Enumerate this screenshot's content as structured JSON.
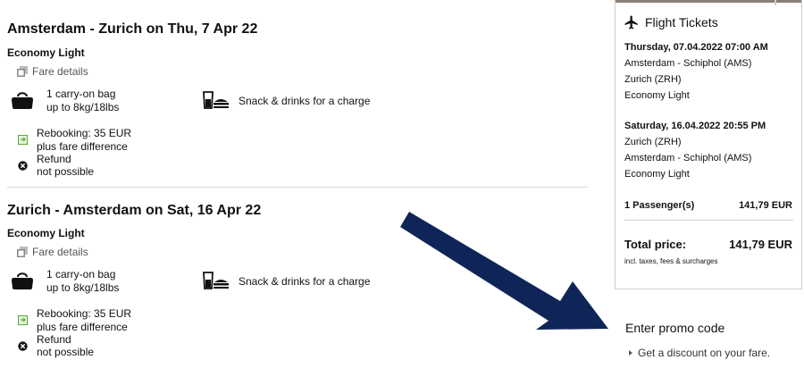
{
  "outbound": {
    "title": "Amsterdam - Zurich on Thu, 7 Apr 22",
    "fare_name": "Economy Light",
    "fare_details_label": "Fare details",
    "bag_line1": "1 carry-on bag",
    "bag_line2": "up to 8kg/18lbs",
    "snack_label": "Snack & drinks for a charge",
    "rebook_line1": "Rebooking: 35 EUR",
    "rebook_line2": "plus fare difference",
    "refund_line1": "Refund",
    "refund_line2": "not possible"
  },
  "inbound": {
    "title": "Zurich - Amsterdam on Sat, 16 Apr 22",
    "fare_name": "Economy Light",
    "fare_details_label": "Fare details",
    "bag_line1": "1 carry-on bag",
    "bag_line2": "up to 8kg/18lbs",
    "snack_label": "Snack & drinks for a charge",
    "rebook_line1": "Rebooking: 35 EUR",
    "rebook_line2": "plus fare difference",
    "refund_line1": "Refund",
    "refund_line2": "not possible"
  },
  "summary": {
    "heading": "Flight Tickets",
    "leg1": {
      "datetime": "Thursday, 07.04.2022 07:00 AM",
      "from": "Amsterdam - Schiphol (AMS)",
      "to": "Zurich (ZRH)",
      "fare": "Economy Light"
    },
    "leg2": {
      "datetime": "Saturday, 16.04.2022 20:55 PM",
      "from": "Zurich (ZRH)",
      "to": "Amsterdam - Schiphol (AMS)",
      "fare": "Economy Light"
    },
    "passengers_label": "1 Passenger(s)",
    "passengers_price": "141,79 EUR",
    "total_label": "Total price:",
    "total_value": "141,79 EUR",
    "total_note": "incl. taxes, fees & surcharges"
  },
  "promo": {
    "title": "Enter promo code",
    "link": "Get a discount on your fare."
  },
  "colors": {
    "arrow": "#0f2557",
    "accent_bar": "#8a7f75",
    "rebook_icon": "#5aa63b"
  },
  "icons": [
    "fare-details-icon",
    "bag-icon",
    "snack-drink-icon",
    "rebooking-icon",
    "refund-cross-icon",
    "airplane-icon",
    "caret-right-icon",
    "annotation-arrow"
  ]
}
